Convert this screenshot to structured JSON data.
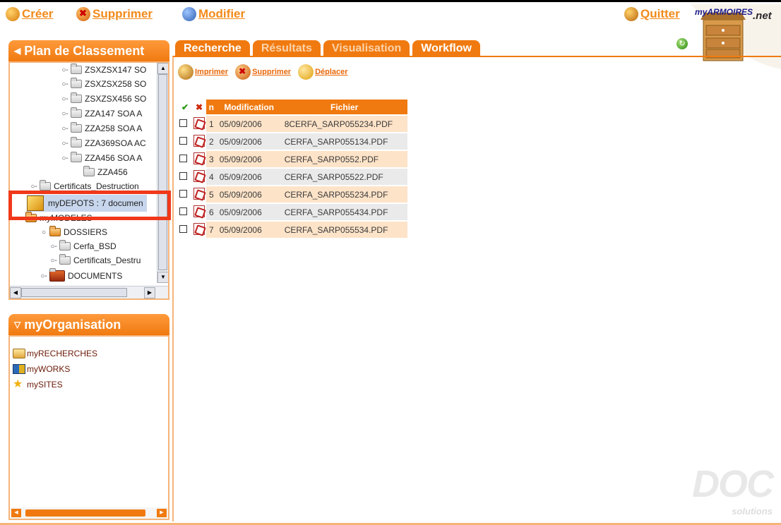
{
  "toolbar": {
    "create_label": "Créer",
    "delete_label": "Supprimer",
    "modify_label": "Modifier",
    "quit_label": "Quitter"
  },
  "logo": {
    "text": "myARMOIRES",
    "suffix": ".net"
  },
  "left_panel": {
    "title": "Plan de Classement",
    "tree": [
      {
        "label": "ZSXZSX147 SO",
        "icon": "folder-icon"
      },
      {
        "label": "ZSXZSX258 SO",
        "icon": "folder-icon"
      },
      {
        "label": "ZSXZSX456 SO",
        "icon": "folder-icon"
      },
      {
        "label": "ZZA147 SOA A",
        "icon": "folder-icon"
      },
      {
        "label": "ZZA258 SOA A",
        "icon": "folder-icon"
      },
      {
        "label": "ZZA369SOA AC",
        "icon": "folder-icon"
      },
      {
        "label": "ZZA456 SOA A",
        "icon": "folder-icon"
      },
      {
        "label": "ZZA456",
        "icon": "folder-icon"
      },
      {
        "label": "Certificats_Destruction",
        "icon": "folder-icon"
      },
      {
        "label": "myDEPOTS : 7 documen",
        "icon": "box-icon"
      },
      {
        "label": "myMODELES",
        "icon": "folder-icon"
      },
      {
        "label": "DOSSIERS",
        "icon": "folder-icon"
      },
      {
        "label": "Cerfa_BSD",
        "icon": "folder-icon"
      },
      {
        "label": "Certificats_Destru",
        "icon": "folder-icon"
      },
      {
        "label": "DOCUMENTS",
        "icon": "folder-icon"
      }
    ]
  },
  "org_panel": {
    "title": "myOrganisation",
    "items": [
      {
        "label": "myRECHERCHES",
        "icon": "search-folder-icon"
      },
      {
        "label": "myWORKS",
        "icon": "works-icon"
      },
      {
        "label": "mySITES",
        "icon": "star-icon"
      }
    ]
  },
  "tabs": [
    {
      "label": "Recherche",
      "active": true
    },
    {
      "label": "Résultats",
      "active": false
    },
    {
      "label": "Visualisation",
      "active": false
    },
    {
      "label": "Workflow",
      "active": true
    }
  ],
  "actions": {
    "print_label": "Imprimer",
    "delete_label": "Supprimer",
    "move_label": "Déplacer"
  },
  "results": {
    "headers": {
      "n": "n",
      "modification": "Modification",
      "file": "Fichier"
    },
    "rows": [
      {
        "n": "1",
        "date": "05/09/2006",
        "file": "8CERFA_SARP055234.PDF"
      },
      {
        "n": "2",
        "date": "05/09/2006",
        "file": "CERFA_SARP055134.PDF"
      },
      {
        "n": "3",
        "date": "05/09/2006",
        "file": "CERFA_SARP0552.PDF"
      },
      {
        "n": "4",
        "date": "05/09/2006",
        "file": "CERFA_SARP05522.PDF"
      },
      {
        "n": "5",
        "date": "05/09/2006",
        "file": "CERFA_SARP055234.PDF"
      },
      {
        "n": "6",
        "date": "05/09/2006",
        "file": "CERFA_SARP055434.PDF"
      },
      {
        "n": "7",
        "date": "05/09/2006",
        "file": "CERFA_SARP055534.PDF"
      }
    ]
  },
  "watermark": {
    "text": "DOC",
    "sub": "solutions"
  },
  "colors": {
    "accent": "#f07a10",
    "highlight": "#f0381a",
    "row_odd": "#fde3c8",
    "row_even": "#eaeaea"
  }
}
